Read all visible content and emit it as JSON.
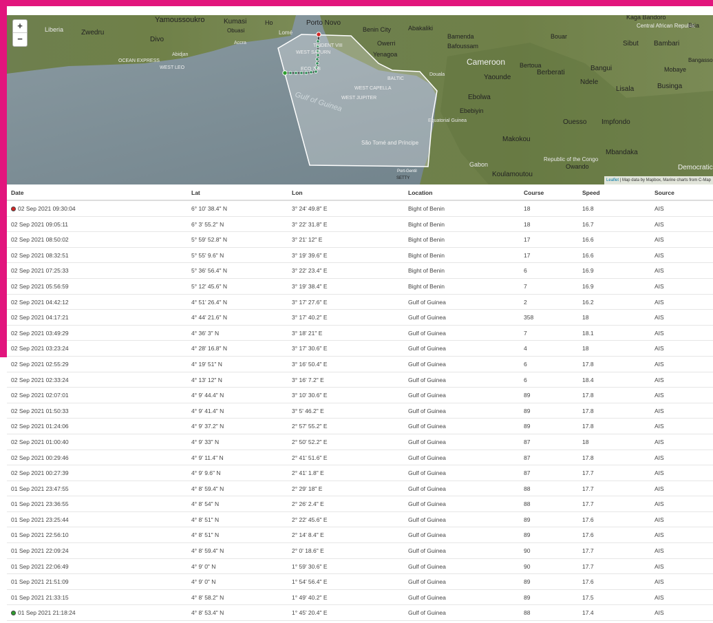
{
  "colors": {
    "brand": "#e2157d",
    "track": "#2e8b57",
    "marker_end": "#d32626",
    "marker_start": "#2e9e2e"
  },
  "map": {
    "zoom_in_label": "+",
    "zoom_out_label": "−",
    "attribution_leaflet": "Leaflet",
    "attribution_text": " | Map data by Mapbox, Marine charts from C-Map",
    "labels": {
      "yamoussoukro": "Yamoussoukro",
      "liberia": "Liberia",
      "zwedru": "Zwedru",
      "divo": "Divo",
      "kumasi": "Kumasi",
      "obuasi": "Obuasi",
      "ho": "Ho",
      "lome": "Lomé",
      "porto_novo": "Porto Novo",
      "benin_city": "Benin City",
      "abakaliki": "Abakaliki",
      "owerri": "Owerri",
      "yenagoa": "Yenagoa",
      "bamenda": "Bamenda",
      "bafoussam": "Bafoussam",
      "cameroon": "Cameroon",
      "yaounde": "Yaounde",
      "ebolwa": "Ebolwa",
      "ebebiyin": "Ebebiyin",
      "equatorial_guinea": "Equatorial Guinea",
      "makokou": "Makokou",
      "gabon": "Gabon",
      "koulamoutou": "Koulamoutou",
      "bertoua": "Bertoua",
      "berberati": "Berberati",
      "ndele": "Ndele",
      "bangui": "Bangui",
      "ouesso": "Ouesso",
      "impfondo": "Impfondo",
      "mbandaka": "Mbandaka",
      "republic_congo": "Republic of the Congo",
      "owando": "Owando",
      "kaga_bandoro": "Kaga Bandoro",
      "car": "Central African Republic",
      "bria": "Bria",
      "sibut": "Sibut",
      "bambari": "Bambari",
      "mobaye": "Mobaye",
      "bangassou": "Bangassou",
      "lisala": "Lisala",
      "businga": "Businga",
      "democratic": "Democratic Republic",
      "gulf_of_guinea": "Gulf of Guinea",
      "bouar": "Bouar",
      "sao_tome": "São Tomé and Príncipe",
      "douala": "Douala",
      "port_gentil": "Port-Gentil",
      "setty": "SETTY",
      "west_capella": "WEST CAPELLA",
      "west_jupiter": "WEST JUPITER",
      "baltic": "BALTIC",
      "trident": "TRIDENT VIII",
      "west_saturn": "WEST SATURN",
      "eco_708": "ECO 708",
      "ocean_express": "OCEAN EXPRESS",
      "west_leo": "WEST LEO",
      "abidjan": "Abidjan",
      "accra": "Accra",
      "bangui2": "Bangui"
    }
  },
  "table": {
    "headers": {
      "date": "Date",
      "lat": "Lat",
      "lon": "Lon",
      "location": "Location",
      "course": "Course",
      "speed": "Speed",
      "source": "Source"
    },
    "rows": [
      {
        "date": "02 Sep 2021 09:30:04",
        "lat": "6° 10' 38.4\" N",
        "lon": "3° 24' 49.8\" E",
        "location": "Bight of Benin",
        "course": "18",
        "speed": "16.8",
        "source": "AIS",
        "marker": "red"
      },
      {
        "date": "02 Sep 2021 09:05:11",
        "lat": "6° 3' 55.2\" N",
        "lon": "3° 22' 31.8\" E",
        "location": "Bight of Benin",
        "course": "18",
        "speed": "16.7",
        "source": "AIS"
      },
      {
        "date": "02 Sep 2021 08:50:02",
        "lat": "5° 59' 52.8\" N",
        "lon": "3° 21' 12\" E",
        "location": "Bight of Benin",
        "course": "17",
        "speed": "16.6",
        "source": "AIS"
      },
      {
        "date": "02 Sep 2021 08:32:51",
        "lat": "5° 55' 9.6\" N",
        "lon": "3° 19' 39.6\" E",
        "location": "Bight of Benin",
        "course": "17",
        "speed": "16.6",
        "source": "AIS"
      },
      {
        "date": "02 Sep 2021 07:25:33",
        "lat": "5° 36' 56.4\" N",
        "lon": "3° 22' 23.4\" E",
        "location": "Bight of Benin",
        "course": "6",
        "speed": "16.9",
        "source": "AIS"
      },
      {
        "date": "02 Sep 2021 05:56:59",
        "lat": "5° 12' 45.6\" N",
        "lon": "3° 19' 38.4\" E",
        "location": "Bight of Benin",
        "course": "7",
        "speed": "16.9",
        "source": "AIS"
      },
      {
        "date": "02 Sep 2021 04:42:12",
        "lat": "4° 51' 26.4\" N",
        "lon": "3° 17' 27.6\" E",
        "location": "Gulf of Guinea",
        "course": "2",
        "speed": "16.2",
        "source": "AIS"
      },
      {
        "date": "02 Sep 2021 04:17:21",
        "lat": "4° 44' 21.6\" N",
        "lon": "3° 17' 40.2\" E",
        "location": "Gulf of Guinea",
        "course": "358",
        "speed": "18",
        "source": "AIS"
      },
      {
        "date": "02 Sep 2021 03:49:29",
        "lat": "4° 36' 3\" N",
        "lon": "3° 18' 21\" E",
        "location": "Gulf of Guinea",
        "course": "7",
        "speed": "18.1",
        "source": "AIS"
      },
      {
        "date": "02 Sep 2021 03:23:24",
        "lat": "4° 28' 16.8\" N",
        "lon": "3° 17' 30.6\" E",
        "location": "Gulf of Guinea",
        "course": "4",
        "speed": "18",
        "source": "AIS"
      },
      {
        "date": "02 Sep 2021 02:55:29",
        "lat": "4° 19' 51\" N",
        "lon": "3° 16' 50.4\" E",
        "location": "Gulf of Guinea",
        "course": "6",
        "speed": "17.8",
        "source": "AIS"
      },
      {
        "date": "02 Sep 2021 02:33:24",
        "lat": "4° 13' 12\" N",
        "lon": "3° 16' 7.2\" E",
        "location": "Gulf of Guinea",
        "course": "6",
        "speed": "18.4",
        "source": "AIS"
      },
      {
        "date": "02 Sep 2021 02:07:01",
        "lat": "4° 9' 44.4\" N",
        "lon": "3° 10' 30.6\" E",
        "location": "Gulf of Guinea",
        "course": "89",
        "speed": "17.8",
        "source": "AIS"
      },
      {
        "date": "02 Sep 2021 01:50:33",
        "lat": "4° 9' 41.4\" N",
        "lon": "3° 5' 46.2\" E",
        "location": "Gulf of Guinea",
        "course": "89",
        "speed": "17.8",
        "source": "AIS"
      },
      {
        "date": "02 Sep 2021 01:24:06",
        "lat": "4° 9' 37.2\" N",
        "lon": "2° 57' 55.2\" E",
        "location": "Gulf of Guinea",
        "course": "89",
        "speed": "17.8",
        "source": "AIS"
      },
      {
        "date": "02 Sep 2021 01:00:40",
        "lat": "4° 9' 33\" N",
        "lon": "2° 50' 52.2\" E",
        "location": "Gulf of Guinea",
        "course": "87",
        "speed": "18",
        "source": "AIS"
      },
      {
        "date": "02 Sep 2021 00:29:46",
        "lat": "4° 9' 11.4\" N",
        "lon": "2° 41' 51.6\" E",
        "location": "Gulf of Guinea",
        "course": "87",
        "speed": "17.8",
        "source": "AIS"
      },
      {
        "date": "02 Sep 2021 00:27:39",
        "lat": "4° 9' 9.6\" N",
        "lon": "2° 41' 1.8\" E",
        "location": "Gulf of Guinea",
        "course": "87",
        "speed": "17.7",
        "source": "AIS"
      },
      {
        "date": "01 Sep 2021 23:47:55",
        "lat": "4° 8' 59.4\" N",
        "lon": "2° 29' 18\" E",
        "location": "Gulf of Guinea",
        "course": "88",
        "speed": "17.7",
        "source": "AIS"
      },
      {
        "date": "01 Sep 2021 23:36:55",
        "lat": "4° 8' 54\" N",
        "lon": "2° 26' 2.4\" E",
        "location": "Gulf of Guinea",
        "course": "88",
        "speed": "17.7",
        "source": "AIS"
      },
      {
        "date": "01 Sep 2021 23:25:44",
        "lat": "4° 8' 51\" N",
        "lon": "2° 22' 45.6\" E",
        "location": "Gulf of Guinea",
        "course": "89",
        "speed": "17.6",
        "source": "AIS"
      },
      {
        "date": "01 Sep 2021 22:56:10",
        "lat": "4° 8' 51\" N",
        "lon": "2° 14' 8.4\" E",
        "location": "Gulf of Guinea",
        "course": "89",
        "speed": "17.6",
        "source": "AIS"
      },
      {
        "date": "01 Sep 2021 22:09:24",
        "lat": "4° 8' 59.4\" N",
        "lon": "2° 0' 18.6\" E",
        "location": "Gulf of Guinea",
        "course": "90",
        "speed": "17.7",
        "source": "AIS"
      },
      {
        "date": "01 Sep 2021 22:06:49",
        "lat": "4° 9' 0\" N",
        "lon": "1° 59' 30.6\" E",
        "location": "Gulf of Guinea",
        "course": "90",
        "speed": "17.7",
        "source": "AIS"
      },
      {
        "date": "01 Sep 2021 21:51:09",
        "lat": "4° 9' 0\" N",
        "lon": "1° 54' 56.4\" E",
        "location": "Gulf of Guinea",
        "course": "89",
        "speed": "17.6",
        "source": "AIS"
      },
      {
        "date": "01 Sep 2021 21:33:15",
        "lat": "4° 8' 58.2\" N",
        "lon": "1° 49' 40.2\" E",
        "location": "Gulf of Guinea",
        "course": "89",
        "speed": "17.5",
        "source": "AIS"
      },
      {
        "date": "01 Sep 2021 21:18:24",
        "lat": "4° 8' 53.4\" N",
        "lon": "1° 45' 20.4\" E",
        "location": "Gulf of Guinea",
        "course": "88",
        "speed": "17.4",
        "source": "AIS",
        "marker": "green"
      }
    ]
  }
}
